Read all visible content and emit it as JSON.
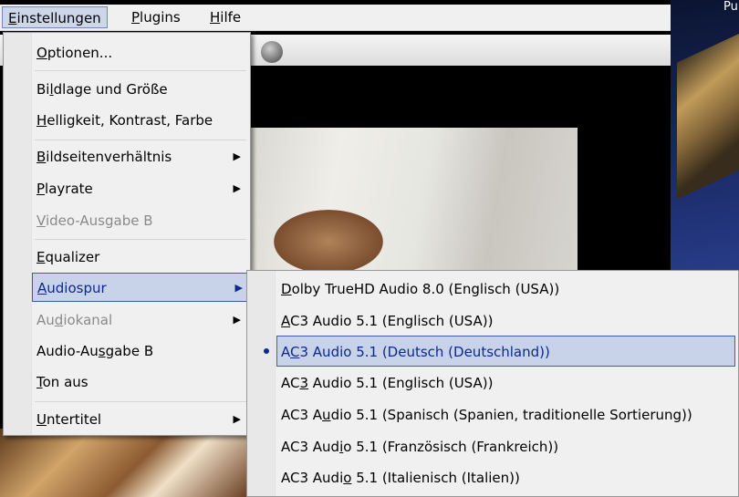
{
  "desktop": {
    "corner_label": "Pu"
  },
  "menubar": {
    "items": [
      {
        "mnemonic": "E",
        "rest": "instellungen"
      },
      {
        "mnemonic": "P",
        "rest": "lugins"
      },
      {
        "mnemonic": "H",
        "rest": "ilfe"
      }
    ]
  },
  "menu": {
    "items": [
      {
        "pre": "",
        "mnemonic": "O",
        "post": "ptionen..."
      },
      {
        "pre": "Bi",
        "mnemonic": "l",
        "post": "dlage und Größe"
      },
      {
        "pre": "",
        "mnemonic": "H",
        "post": "elligkeit, Kontrast, Farbe"
      },
      {
        "pre": "",
        "mnemonic": "B",
        "post": "ildseitenverhältnis"
      },
      {
        "pre": "",
        "mnemonic": "P",
        "post": "layrate"
      },
      {
        "pre": "",
        "mnemonic": "V",
        "post": "ideo-Ausgabe B"
      },
      {
        "pre": "",
        "mnemonic": "E",
        "post": "qualizer"
      },
      {
        "pre": "",
        "mnemonic": "A",
        "post": "udiospur"
      },
      {
        "pre": "Au",
        "mnemonic": "d",
        "post": "iokanal"
      },
      {
        "pre": "Audio-Au",
        "mnemonic": "s",
        "post": "gabe B"
      },
      {
        "pre": "",
        "mnemonic": "T",
        "post": "on aus"
      },
      {
        "pre": "",
        "mnemonic": "U",
        "post": "ntertitel"
      }
    ],
    "submenu_arrow": "▶"
  },
  "audio_tracks": {
    "items": [
      {
        "pre": "",
        "mnemonic": "D",
        "post": "olby TrueHD Audio 8.0 (Englisch (USA))"
      },
      {
        "pre": "",
        "mnemonic": "A",
        "post": "C3 Audio 5.1 (Englisch (USA))"
      },
      {
        "pre": "A",
        "mnemonic": "C",
        "post": "3 Audio 5.1 (Deutsch (Deutschland))"
      },
      {
        "pre": "AC",
        "mnemonic": "3",
        "post": " Audio 5.1 (Englisch (USA))"
      },
      {
        "pre": "AC3 A",
        "mnemonic": "u",
        "post": "dio 5.1 (Spanisch (Spanien, traditionelle Sortierung))"
      },
      {
        "pre": "AC3 Aud",
        "mnemonic": "i",
        "post": "o 5.1 (Französisch (Frankreich))"
      },
      {
        "pre": "AC3 Audi",
        "mnemonic": "o",
        "post": " 5.1 (Italienisch (Italien))"
      }
    ],
    "selected_index": 2
  }
}
